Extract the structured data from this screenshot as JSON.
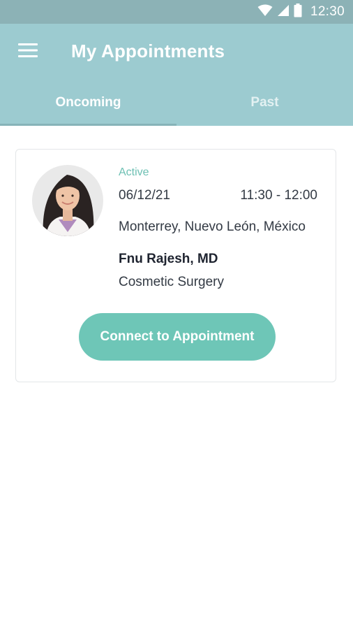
{
  "status_bar": {
    "time": "12:30",
    "icons": [
      "wifi-icon",
      "cellular-signal-icon",
      "battery-icon"
    ]
  },
  "header": {
    "title": "My Appointments",
    "menu_icon": "hamburger-menu-icon"
  },
  "tabs": [
    {
      "label": "Oncoming",
      "selected": true
    },
    {
      "label": "Past",
      "selected": false
    }
  ],
  "appointment": {
    "status": "Active",
    "date": "06/12/21",
    "time": "11:30 - 12:00",
    "location": "Monterrey, Nuevo León, México",
    "doctor_name": "Fnu Rajesh, MD",
    "specialty": "Cosmetic Surgery",
    "connect_label": "Connect to Appointment"
  },
  "colors": {
    "status_bar": "#8cb2b6",
    "app_bar": "#9ccbd0",
    "accent": "#6ec6b7",
    "status_text": "#6dc0b3"
  }
}
